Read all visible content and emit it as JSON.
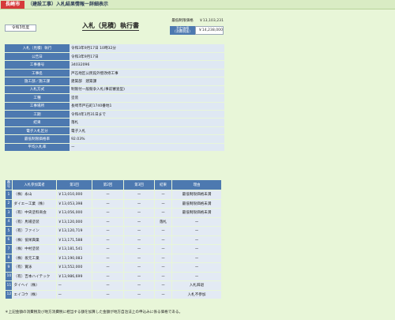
{
  "header": {
    "city": "長崎市",
    "page_title": "（建設工事）入札結果情報ー詳細表示"
  },
  "fiscal_year": "令和3年度",
  "doc_title": "入札（見積）執行書",
  "prices": {
    "min_limit_label": "最低制限価格",
    "min_limit_value": "￥13,103,231",
    "est_label_line1": "予定価格",
    "est_label_line2": "（消費税抜）",
    "est_value": "￥14,238,000"
  },
  "info": [
    {
      "label": "入札（見積）執行",
      "value": "令和3年9月17日 10時32分"
    },
    {
      "label": "公告日",
      "value": "令和3年9月17日"
    },
    {
      "label": "工事番号",
      "value": "34032096"
    },
    {
      "label": "工事名",
      "value": "戸石地区公民館外壁改修工事"
    },
    {
      "label": "施工部／施工課",
      "value": "建築部　建築課"
    },
    {
      "label": "入札方式",
      "value": "制限付一般競争入札(事前審査型)"
    },
    {
      "label": "工種",
      "value": "塗装"
    },
    {
      "label": "工事場所",
      "value": "長崎市戸石町1740番地1"
    },
    {
      "label": "工期",
      "value": "令和4年1月31日まで"
    },
    {
      "label": "結果",
      "value": "落札"
    },
    {
      "label": "電子入札区分",
      "value": "電子入札"
    },
    {
      "label": "最低制限価格率",
      "value": "92.03%"
    },
    {
      "label": "平均入札率",
      "value": "ー"
    }
  ],
  "bids_header": {
    "no": "番号",
    "bidder": "入札参加業者",
    "round1": "第1回",
    "round2": "第2回",
    "round3": "第3回",
    "result": "結果",
    "reason": "理由"
  },
  "bids": [
    {
      "no": "1",
      "name": "（株）永山",
      "r1": "￥13,010,000",
      "r2": "ー",
      "r3": "ー",
      "result": "ー",
      "reason": "最低制限価格未満"
    },
    {
      "no": "2",
      "name": "ダイエー工業（株）",
      "r1": "￥13,053,398",
      "r2": "ー",
      "r3": "ー",
      "result": "ー",
      "reason": "最低制限価格未満"
    },
    {
      "no": "3",
      "name": "（有）中央塗料商会",
      "r1": "￥13,056,000",
      "r2": "ー",
      "r3": "ー",
      "result": "ー",
      "reason": "最低制限価格未満"
    },
    {
      "no": "4",
      "name": "（有）馬場塗装",
      "r1": "￥13,120,000",
      "r2": "ー",
      "r3": "ー",
      "result": "落札",
      "reason": "ー"
    },
    {
      "no": "5",
      "name": "（有）ファイン",
      "r1": "￥13,120,719",
      "r2": "ー",
      "r3": "ー",
      "result": "ー",
      "reason": "ー"
    },
    {
      "no": "6",
      "name": "（株）協栄興業",
      "r1": "￥13,171,588",
      "r2": "ー",
      "r3": "ー",
      "result": "ー",
      "reason": "ー"
    },
    {
      "no": "7",
      "name": "（株）中村塗装",
      "r1": "￥13,181,541",
      "r2": "ー",
      "r3": "ー",
      "result": "ー",
      "reason": "ー"
    },
    {
      "no": "8",
      "name": "（株）坂元工業",
      "r1": "￥13,190,083",
      "r2": "ー",
      "r3": "ー",
      "result": "ー",
      "reason": "ー"
    },
    {
      "no": "9",
      "name": "（有）賞泳",
      "r1": "￥13,552,000",
      "r2": "ー",
      "r3": "ー",
      "result": "ー",
      "reason": "ー"
    },
    {
      "no": "10",
      "name": "（有）吉本ハイテック",
      "r1": "￥13,986,699",
      "r2": "ー",
      "r3": "ー",
      "result": "ー",
      "reason": "ー"
    },
    {
      "no": "11",
      "name": "タイヘイ（株）",
      "r1": "ー",
      "r2": "ー",
      "r3": "ー",
      "result": "ー",
      "reason": "入札辞退"
    },
    {
      "no": "12",
      "name": "エイコウ（株）",
      "r1": "ー",
      "r2": "ー",
      "r3": "ー",
      "result": "ー",
      "reason": "入札不参加"
    }
  ],
  "footnote": "＊上記金額の消費税及び地方消費税に相当する額を加算した金額が地方自治法上の申込みに係る価格である。"
}
